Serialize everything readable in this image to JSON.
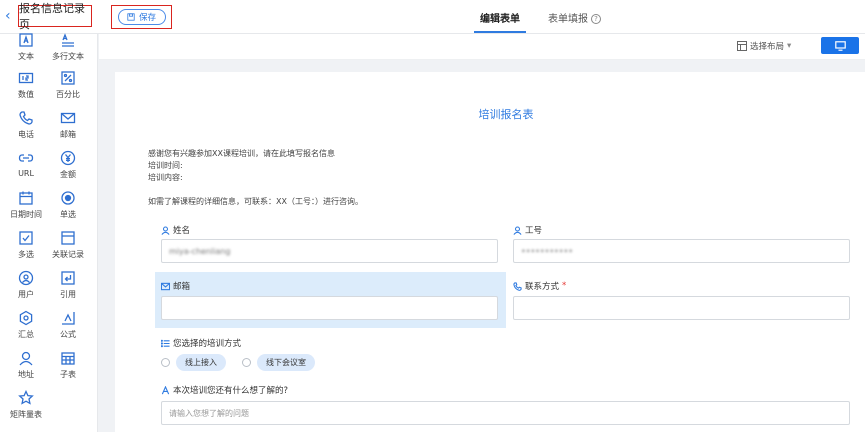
{
  "header": {
    "back_icon": "chevron-left-icon",
    "title": "报名信息记录页",
    "save_label": "保存",
    "tabs": [
      {
        "label": "编辑表单",
        "active": true
      },
      {
        "label": "表单填报",
        "active": false
      }
    ],
    "help_glyph": "?"
  },
  "sidebar": {
    "items": [
      {
        "label": "文本",
        "icon": "text-icon"
      },
      {
        "label": "多行文本",
        "icon": "multiline-text-icon"
      },
      {
        "label": "数值",
        "icon": "number-icon"
      },
      {
        "label": "百分比",
        "icon": "percent-icon"
      },
      {
        "label": "电话",
        "icon": "phone-icon"
      },
      {
        "label": "邮箱",
        "icon": "mail-icon"
      },
      {
        "label": "URL",
        "icon": "link-icon"
      },
      {
        "label": "金额",
        "icon": "currency-icon"
      },
      {
        "label": "日期时间",
        "icon": "calendar-icon"
      },
      {
        "label": "单选",
        "icon": "radio-icon"
      },
      {
        "label": "多选",
        "icon": "checkbox-icon"
      },
      {
        "label": "关联记录",
        "icon": "relation-icon"
      },
      {
        "label": "用户",
        "icon": "user-icon"
      },
      {
        "label": "引用",
        "icon": "reference-icon"
      },
      {
        "label": "汇总",
        "icon": "summary-icon"
      },
      {
        "label": "公式",
        "icon": "formula-icon"
      },
      {
        "label": "地址",
        "icon": "address-icon"
      },
      {
        "label": "子表",
        "icon": "subtable-icon"
      },
      {
        "label": "矩阵量表",
        "icon": "matrix-scale-icon"
      }
    ]
  },
  "toolbar": {
    "layout_label": "选择布局",
    "layout_arrow": "▾",
    "device_icon": "desktop-icon"
  },
  "form": {
    "title": "培训报名表",
    "description": [
      "感谢您有兴趣参加XX课程培训，请在此填写报名信息",
      "培训时间:",
      "培训内容:",
      "",
      "如需了解课程的详细信息，可联系：XX（工号：）进行咨询。"
    ],
    "fields": {
      "name": {
        "label": "姓名",
        "value": "miya-chenliang"
      },
      "employee_id": {
        "label": "工号",
        "value": "•••••••••••"
      },
      "email": {
        "label": "邮箱",
        "value": ""
      },
      "contact": {
        "label": "联系方式",
        "required_mark": "*",
        "value": ""
      },
      "training_mode": {
        "label": "您选择的培训方式",
        "options": [
          "线上接入",
          "线下会议室"
        ]
      },
      "question": {
        "label": "本次培训您还有什么想了解的?",
        "placeholder": "请输入您想了解的问题"
      }
    }
  },
  "colors": {
    "accent": "#2f7be0",
    "annotation_red": "#d9251f",
    "highlight": "#dcecfb"
  }
}
